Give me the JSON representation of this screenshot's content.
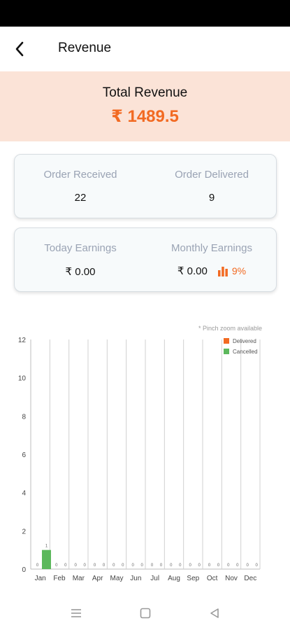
{
  "header": {
    "title": "Revenue",
    "back_icon": "chevron-left-icon"
  },
  "revenue": {
    "label": "Total Revenue",
    "value": "₹ 1489.5"
  },
  "stats": {
    "order_received_label": "Order Received",
    "order_received_value": "22",
    "order_delivered_label": "Order Delivered",
    "order_delivered_value": "9",
    "today_earnings_label": "Today Earnings",
    "today_earnings_value": "₹ 0.00",
    "monthly_earnings_label": "Monthly Earnings",
    "monthly_earnings_value": "₹ 0.00",
    "monthly_growth": "9%",
    "growth_icon": "bar-chart-icon"
  },
  "chart_note": "* Pinch zoom available",
  "colors": {
    "accent": "#f26a22",
    "revenue_bg": "#fbe3d7",
    "delivered": "#f26a22",
    "cancelled": "#5cb85c"
  },
  "chart_data": {
    "type": "bar",
    "categories": [
      "Jan",
      "Feb",
      "Mar",
      "Apr",
      "May",
      "Jun",
      "Jul",
      "Aug",
      "Sep",
      "Oct",
      "Nov",
      "Dec"
    ],
    "series": [
      {
        "name": "Delivered",
        "values": [
          0,
          0,
          0,
          0,
          0,
          0,
          0,
          0,
          0,
          0,
          0,
          0
        ]
      },
      {
        "name": "Cancelled",
        "values": [
          1,
          0,
          0,
          0,
          0,
          0,
          0,
          0,
          0,
          0,
          0,
          0
        ]
      }
    ],
    "y_ticks": [
      "0",
      "2",
      "4",
      "6",
      "8",
      "10",
      "12"
    ],
    "ylim": [
      0,
      12
    ],
    "legend_position": "top-right",
    "grid": "vertical"
  },
  "nav": {
    "recents_icon": "menu-icon",
    "home_icon": "square-icon",
    "back_icon": "triangle-back-icon"
  }
}
